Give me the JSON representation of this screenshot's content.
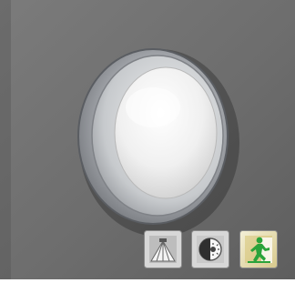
{
  "product": {
    "image_subject": "round-wall-luminaire",
    "background_color": "#6e6e6e",
    "ring_color": "#b9bcc0",
    "diffuser_color": "#f2f2f2"
  },
  "feature_badges": [
    {
      "icon": "motion-sensor-icon",
      "background_color": "#d7d7d7"
    },
    {
      "icon": "light-sensor-icon",
      "background_color": "#d7d7d7"
    },
    {
      "icon": "emergency-exit-icon",
      "accent": "#2aa33a",
      "background_color": "#d9c98a"
    }
  ]
}
